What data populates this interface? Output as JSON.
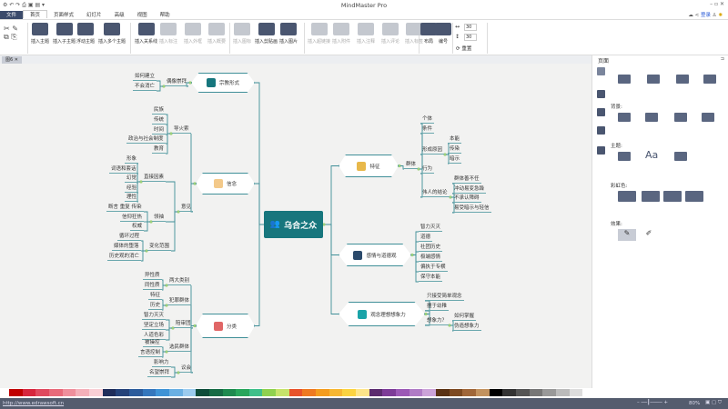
{
  "app": {
    "title": "MindMaster Pro",
    "login": "登录"
  },
  "menu": [
    "文件",
    "首页",
    "页面样式",
    "幻灯片",
    "高级",
    "视图",
    "帮助"
  ],
  "ribbon": {
    "buttons": [
      {
        "label": "插入主题",
        "enabled": true
      },
      {
        "label": "插入子主题",
        "enabled": true
      },
      {
        "label": "浮动主题",
        "enabled": true
      },
      {
        "label": "插入多个主题",
        "enabled": true
      },
      {
        "label": "插入关系线",
        "enabled": true
      },
      {
        "label": "插入标注",
        "enabled": false
      },
      {
        "label": "插入外框",
        "enabled": false
      },
      {
        "label": "插入概要",
        "enabled": false
      },
      {
        "label": "插入图标",
        "enabled": false
      },
      {
        "label": "插入剪贴画",
        "enabled": true
      },
      {
        "label": "插入图片",
        "enabled": true
      },
      {
        "label": "插入超链接",
        "enabled": false
      },
      {
        "label": "插入附件",
        "enabled": false
      },
      {
        "label": "插入注释",
        "enabled": false
      },
      {
        "label": "插入评论",
        "enabled": false
      },
      {
        "label": "插入标签",
        "enabled": false
      },
      {
        "label": "布局",
        "enabled": true
      },
      {
        "label": "编号",
        "enabled": true
      }
    ],
    "spacing_h": "30",
    "spacing_v": "30",
    "reset": "重置"
  },
  "doc_tab": "图6",
  "panel": {
    "title": "页面",
    "background": "背景:",
    "theme": "主题:",
    "rainbow": "彩虹色:",
    "effect": "效果:"
  },
  "mindmap": {
    "center": "乌合之众",
    "topics": [
      {
        "label": "宗教形式",
        "side": "left",
        "icon_color": "#17767d",
        "children": [
          {
            "label": "偶像崇拜",
            "children": [
              {
                "label": "如何建立"
              },
              {
                "label": "不会消亡"
              }
            ]
          }
        ]
      },
      {
        "label": "信念",
        "side": "left",
        "icon_color": "#f3c98a",
        "children": [
          {
            "label": "导火索",
            "children": [
              {
                "label": "民族"
              },
              {
                "label": "传统"
              },
              {
                "label": "时间"
              },
              {
                "label": "政治与社会制度"
              },
              {
                "label": "教育"
              }
            ]
          },
          {
            "label": "意见",
            "children": [
              {
                "label": "直接因素",
                "children": [
                  {
                    "label": "形象"
                  },
                  {
                    "label": "词语和套话"
                  },
                  {
                    "label": "幻觉"
                  },
                  {
                    "label": "经验"
                  },
                  {
                    "label": "理性"
                  }
                ]
              },
              {
                "label": "领袖",
                "children": [
                  {
                    "label": "断言 重复 传染"
                  },
                  {
                    "label": "信仰狂热"
                  },
                  {
                    "label": "权威"
                  }
                ]
              },
              {
                "label": "变化范围",
                "children": [
                  {
                    "label": "循环过程"
                  },
                  {
                    "label": "媒体的堕落"
                  },
                  {
                    "label": "历史观的消亡"
                  }
                ]
              }
            ]
          }
        ]
      },
      {
        "label": "分类",
        "side": "left",
        "icon_color": "#e06666",
        "children": [
          {
            "label": "两大类别",
            "children": [
              {
                "label": "异性质"
              },
              {
                "label": "同性质"
              }
            ]
          },
          {
            "label": "犯罪群体",
            "children": [
              {
                "label": "特征"
              },
              {
                "label": "历史"
              }
            ]
          },
          {
            "label": "陪审团",
            "children": [
              {
                "label": "智力灭灭"
              },
              {
                "label": "坚定立场"
              },
              {
                "label": "人道色彩"
              }
            ]
          },
          {
            "label": "选民群体",
            "children": [
              {
                "label": "被操控"
              },
              {
                "label": "言语控制"
              }
            ]
          },
          {
            "label": "议会",
            "children": [
              {
                "label": "影响力"
              },
              {
                "label": "名望崇拜"
              }
            ]
          }
        ]
      },
      {
        "label": "特征",
        "side": "right",
        "icon_color": "#e8b84a",
        "children": [
          {
            "label": "群体",
            "children": [
              {
                "label": "个体"
              },
              {
                "label": "条件"
              },
              {
                "label": "形成原因",
                "children": [
                  {
                    "label": "本能"
                  },
                  {
                    "label": "传染"
                  },
                  {
                    "label": "暗示"
                  }
                ]
              },
              {
                "label": "行为"
              },
              {
                "label": "伟人的结论",
                "children": [
                  {
                    "label": "群体善不任"
                  },
                  {
                    "label": "冲动易变急躁"
                  },
                  {
                    "label": "不承认障碍"
                  },
                  {
                    "label": "易受暗示与轻信"
                  }
                ]
              }
            ]
          }
        ]
      },
      {
        "label": "感情与道德观",
        "side": "right",
        "icon_color": "#2b4a6b",
        "children": [
          {
            "label": "智力灭灭"
          },
          {
            "label": "道德"
          },
          {
            "label": "社团历史"
          },
          {
            "label": "极端感情"
          },
          {
            "label": "偏执于专横"
          },
          {
            "label": "保守本能"
          }
        ]
      },
      {
        "label": "观念理想想象力",
        "side": "right",
        "icon_color": "#1aa3a8",
        "children": [
          {
            "label": "只接受简单观念"
          },
          {
            "label": "擅于幼稚"
          },
          {
            "label": "想象力？",
            "children": [
              {
                "label": "如何掌握"
              },
              {
                "label": "伪造想象力"
              }
            ]
          }
        ]
      }
    ]
  },
  "colors": {
    "accent": "#17767d",
    "line": "#3f8f98",
    "file_menu": "#3b4b6b"
  },
  "palette": [
    "#c00000",
    "#d7263d",
    "#e04a5f",
    "#e86a7a",
    "#ef8f9c",
    "#f4b0b9",
    "#f8cfd5",
    "#1f2d5a",
    "#25437a",
    "#2c5c9c",
    "#3577bd",
    "#3f93d6",
    "#6ab0e3",
    "#9bcbee",
    "#0e4d3a",
    "#176b45",
    "#1e8a4f",
    "#28a65c",
    "#3fbf8a",
    "#8fd14f",
    "#c6e36b",
    "#e8532b",
    "#ee7a22",
    "#f39c1f",
    "#f7b733",
    "#fbd341",
    "#fde58a",
    "#5b2c6f",
    "#7d3c98",
    "#9b59b6",
    "#b07cc6",
    "#cba3d8",
    "#5a3214",
    "#7d4a22",
    "#a0673a",
    "#c2925f",
    "#000000",
    "#333333",
    "#555555",
    "#777777",
    "#999999",
    "#bbbbbb",
    "#dddddd"
  ],
  "status": {
    "url": "http://www.edrawsoft.cn",
    "zoom": "80%"
  }
}
